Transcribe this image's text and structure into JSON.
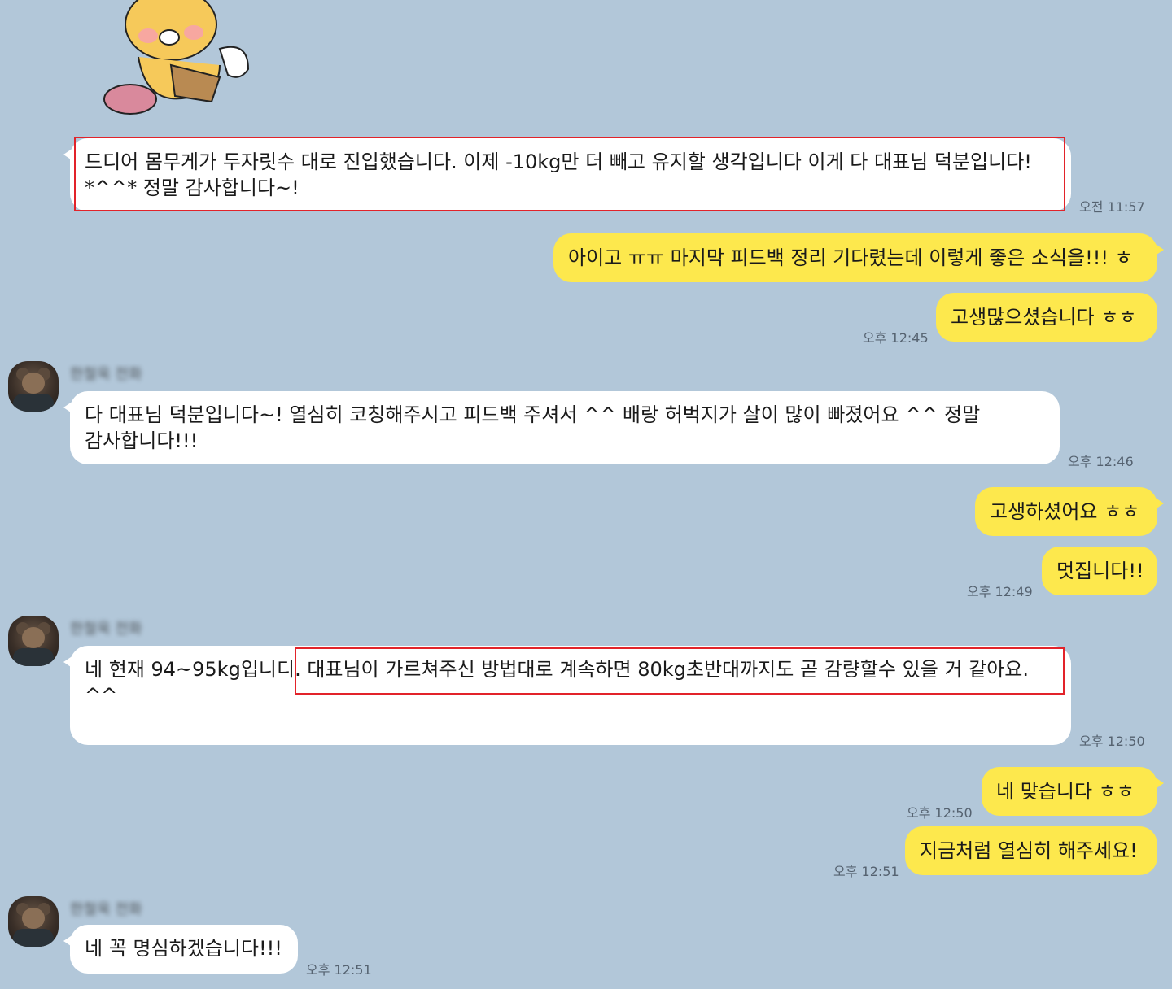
{
  "sticker": {
    "name": "bear-sticker"
  },
  "messages": [
    {
      "text": "드디어 몸무게가 두자릿수 대로 진입했습니다. 이제 -10kg만 더 빼고 유지할 생각입니다 이게 다 대표님 덕분입니다! *^^* 정말 감사합니다~!",
      "time": "오전 11:57"
    },
    {
      "text": "아이고 ㅠㅠ 마지막 피드백 정리 기다렸는데 이렇게 좋은 소식을!!! ㅎ"
    },
    {
      "text": "고생많으셨습니다 ㅎㅎ",
      "time": "오후 12:45"
    },
    {
      "sender": "한철욱 전화",
      "text": "다 대표님 덕분입니다~! 열심히 코칭해주시고 피드백 주셔서 ^^ 배랑 허벅지가 살이 많이 빠졌어요 ^^ 정말 감사합니다!!!",
      "time": "오후 12:46"
    },
    {
      "text": "고생하셨어요 ㅎㅎ"
    },
    {
      "text": "멋집니다!!",
      "time": "오후 12:49"
    },
    {
      "sender": "한철욱 전화",
      "text_a": "네 현재 94~95kg입니디",
      "text_b": ". 대표님이 가르쳐주신 방법대로 계속하면 80kg초반대까지도 곧 감량할수 있을 거 같아요.",
      "text_c": "^^",
      "time": "오후 12:50"
    },
    {
      "text": "네 맞습니다 ㅎㅎ",
      "time": "오후 12:50"
    },
    {
      "text": "지금처럼 열심히 해주세요!",
      "time": "오후 12:51"
    },
    {
      "sender": "한철욱 전화",
      "text": "네 꼭 명심하겠습니다!!!",
      "time": "오후 12:51"
    }
  ],
  "colors": {
    "background": "#b2c7d9",
    "incoming": "#ffffff",
    "outgoing": "#fde84d",
    "highlight": "#e2232a"
  }
}
